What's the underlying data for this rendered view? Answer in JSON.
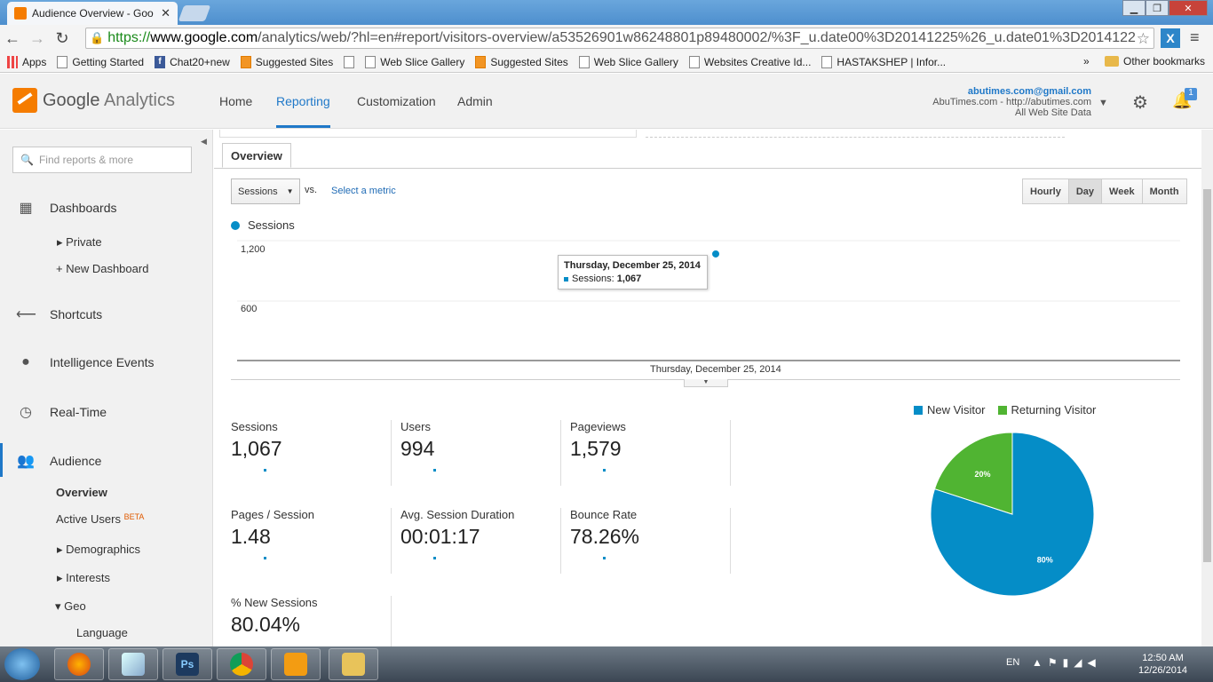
{
  "browser": {
    "tab_title": "Audience Overview - Goo",
    "url_scheme": "https://",
    "url_host": "www.google.com",
    "url_path": "/analytics/web/?hl=en#report/visitors-overview/a53526901w86248801p89480002/%3F_u.date00%3D20141225%26_u.date01%3D2014122",
    "ext_label": "X",
    "bookmarks": [
      "Apps",
      "Getting Started",
      "Chat20+new",
      "Suggested Sites",
      "Web Slice Gallery",
      "Suggested Sites",
      "Web Slice Gallery",
      "Websites Creative Id...",
      "HASTAKSHEP | Infor..."
    ],
    "more": "»",
    "other_bookmarks": "Other bookmarks"
  },
  "ga": {
    "brand_google": "Google",
    "brand_analytics": "Analytics",
    "nav": [
      "Home",
      "Reporting",
      "Customization",
      "Admin"
    ],
    "account_email": "abutimes.com@gmail.com",
    "account_property": "AbuTimes.com - http://abutimes.com",
    "account_view": "All Web Site Data",
    "notif_badge": "1"
  },
  "sidebar": {
    "search_placeholder": "Find reports & more",
    "dashboards": "Dashboards",
    "private": "Private",
    "new_dashboard": "+ New Dashboard",
    "shortcuts": "Shortcuts",
    "intelligence": "Intelligence Events",
    "realtime": "Real-Time",
    "audience": "Audience",
    "overview": "Overview",
    "active_users": "Active Users",
    "beta": "BETA",
    "demographics": "Demographics",
    "interests": "Interests",
    "geo": "Geo",
    "language": "Language"
  },
  "main": {
    "tab": "Overview",
    "metric_select": "Sessions",
    "vs": "vs.",
    "select_metric": "Select a metric",
    "granularity": [
      "Hourly",
      "Day",
      "Week",
      "Month"
    ],
    "granularity_selected": "Day",
    "legend": "Sessions",
    "tooltip_date": "Thursday, December 25, 2014",
    "tooltip_label": "Sessions:",
    "tooltip_value": "1,067",
    "x_label": "Thursday, December 25, 2014"
  },
  "stats": [
    {
      "label": "Sessions",
      "value": "1,067"
    },
    {
      "label": "Users",
      "value": "994"
    },
    {
      "label": "Pageviews",
      "value": "1,579"
    },
    {
      "label": "Pages / Session",
      "value": "1.48"
    },
    {
      "label": "Avg. Session Duration",
      "value": "00:01:17"
    },
    {
      "label": "Bounce Rate",
      "value": "78.26%"
    },
    {
      "label": "% New Sessions",
      "value": "80.04%"
    }
  ],
  "pie": {
    "legend": [
      "New Visitor",
      "Returning Visitor"
    ],
    "colors": [
      "#058dc7",
      "#50b432"
    ],
    "slices": [
      {
        "name": "New Visitor",
        "percent": 80,
        "label": "80%"
      },
      {
        "name": "Returning Visitor",
        "percent": 20,
        "label": "20%"
      }
    ]
  },
  "chart_data": {
    "type": "line",
    "series": [
      {
        "name": "Sessions",
        "values": [
          1067
        ]
      }
    ],
    "x": [
      "Thursday, December 25, 2014"
    ],
    "y_ticks": [
      "1,200",
      "600"
    ],
    "ylim": [
      0,
      1200
    ],
    "color": "#058dc7"
  },
  "taskbar": {
    "lang": "EN",
    "time": "12:50 AM",
    "date": "12/26/2014"
  }
}
